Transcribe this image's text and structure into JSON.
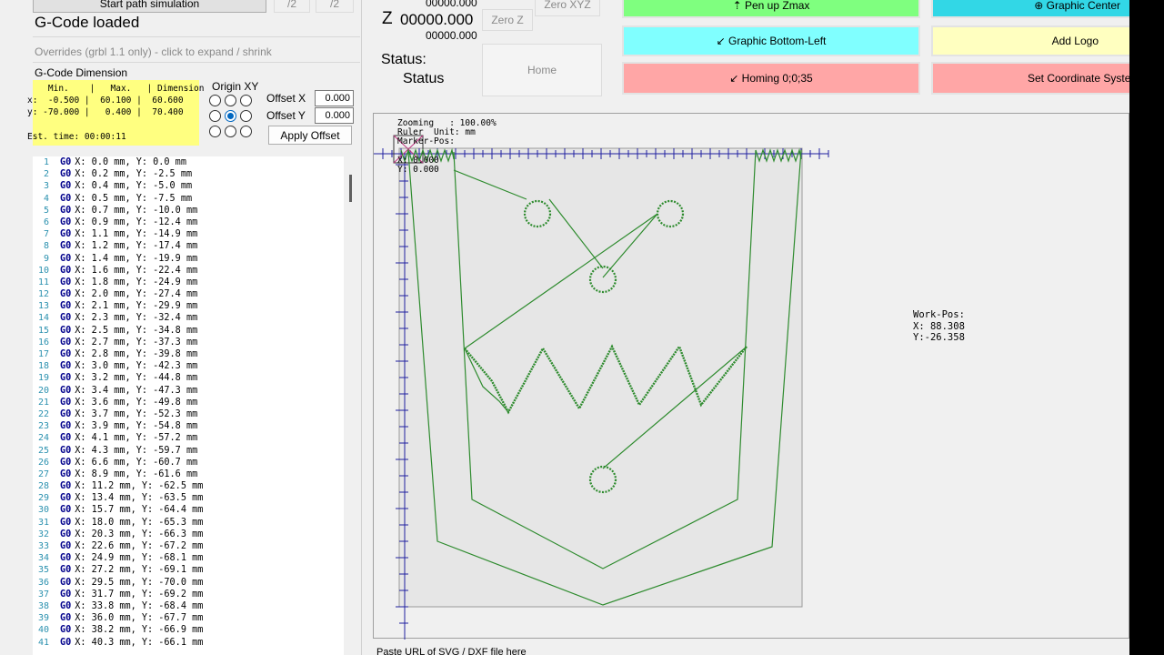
{
  "left_panel": {
    "sim_button": "Start path simulation",
    "small_btn_1": "/2",
    "small_btn_2": "/2",
    "gcode_status": "G-Code loaded",
    "overrides_text": "Overrides (grbl 1.1 only) - click to expand / shrink",
    "dimension_title": "G-Code Dimension",
    "dim_table": {
      "header": "    Min.    |   Max.   | Dimension",
      "row_x": "x:  -0.500 |  60.100 |  60.600",
      "row_y": "y: -70.000 |   0.400 |  70.400",
      "est_time": "Est. time: 00:00:11"
    },
    "origin_label": "Origin XY",
    "offset_x_label": "Offset X",
    "offset_x_value": "0.000",
    "offset_y_label": "Offset Y",
    "offset_y_value": "0.000",
    "apply_offset": "Apply Offset"
  },
  "gcode_lines": [
    {
      "n": "1",
      "cmd": "G0",
      "txt": "X: 0.0 mm, Y: 0.0 mm"
    },
    {
      "n": "2",
      "cmd": "G0",
      "txt": "X: 0.2 mm, Y: -2.5 mm"
    },
    {
      "n": "3",
      "cmd": "G0",
      "txt": "X: 0.4 mm, Y: -5.0 mm"
    },
    {
      "n": "4",
      "cmd": "G0",
      "txt": "X: 0.5 mm, Y: -7.5 mm"
    },
    {
      "n": "5",
      "cmd": "G0",
      "txt": "X: 0.7 mm, Y: -10.0 mm"
    },
    {
      "n": "6",
      "cmd": "G0",
      "txt": "X: 0.9 mm, Y: -12.4 mm"
    },
    {
      "n": "7",
      "cmd": "G0",
      "txt": "X: 1.1 mm, Y: -14.9 mm"
    },
    {
      "n": "8",
      "cmd": "G0",
      "txt": "X: 1.2 mm, Y: -17.4 mm"
    },
    {
      "n": "9",
      "cmd": "G0",
      "txt": "X: 1.4 mm, Y: -19.9 mm"
    },
    {
      "n": "10",
      "cmd": "G0",
      "txt": "X: 1.6 mm, Y: -22.4 mm"
    },
    {
      "n": "11",
      "cmd": "G0",
      "txt": "X: 1.8 mm, Y: -24.9 mm"
    },
    {
      "n": "12",
      "cmd": "G0",
      "txt": "X: 2.0 mm, Y: -27.4 mm"
    },
    {
      "n": "13",
      "cmd": "G0",
      "txt": "X: 2.1 mm, Y: -29.9 mm"
    },
    {
      "n": "14",
      "cmd": "G0",
      "txt": "X: 2.3 mm, Y: -32.4 mm"
    },
    {
      "n": "15",
      "cmd": "G0",
      "txt": "X: 2.5 mm, Y: -34.8 mm"
    },
    {
      "n": "16",
      "cmd": "G0",
      "txt": "X: 2.7 mm, Y: -37.3 mm"
    },
    {
      "n": "17",
      "cmd": "G0",
      "txt": "X: 2.8 mm, Y: -39.8 mm"
    },
    {
      "n": "18",
      "cmd": "G0",
      "txt": "X: 3.0 mm, Y: -42.3 mm"
    },
    {
      "n": "19",
      "cmd": "G0",
      "txt": "X: 3.2 mm, Y: -44.8 mm"
    },
    {
      "n": "20",
      "cmd": "G0",
      "txt": "X: 3.4 mm, Y: -47.3 mm"
    },
    {
      "n": "21",
      "cmd": "G0",
      "txt": "X: 3.6 mm, Y: -49.8 mm"
    },
    {
      "n": "22",
      "cmd": "G0",
      "txt": "X: 3.7 mm, Y: -52.3 mm"
    },
    {
      "n": "23",
      "cmd": "G0",
      "txt": "X: 3.9 mm, Y: -54.8 mm"
    },
    {
      "n": "24",
      "cmd": "G0",
      "txt": "X: 4.1 mm, Y: -57.2 mm"
    },
    {
      "n": "25",
      "cmd": "G0",
      "txt": "X: 4.3 mm, Y: -59.7 mm"
    },
    {
      "n": "26",
      "cmd": "G0",
      "txt": "X: 6.6 mm, Y: -60.7 mm"
    },
    {
      "n": "27",
      "cmd": "G0",
      "txt": "X: 8.9 mm, Y: -61.6 mm"
    },
    {
      "n": "28",
      "cmd": "G0",
      "txt": "X: 11.2 mm, Y: -62.5 mm"
    },
    {
      "n": "29",
      "cmd": "G0",
      "txt": "X: 13.4 mm, Y: -63.5 mm"
    },
    {
      "n": "30",
      "cmd": "G0",
      "txt": "X: 15.7 mm, Y: -64.4 mm"
    },
    {
      "n": "31",
      "cmd": "G0",
      "txt": "X: 18.0 mm, Y: -65.3 mm"
    },
    {
      "n": "32",
      "cmd": "G0",
      "txt": "X: 20.3 mm, Y: -66.3 mm"
    },
    {
      "n": "33",
      "cmd": "G0",
      "txt": "X: 22.6 mm, Y: -67.2 mm"
    },
    {
      "n": "34",
      "cmd": "G0",
      "txt": "X: 24.9 mm, Y: -68.1 mm"
    },
    {
      "n": "35",
      "cmd": "G0",
      "txt": "X: 27.2 mm, Y: -69.1 mm"
    },
    {
      "n": "36",
      "cmd": "G0",
      "txt": "X: 29.5 mm, Y: -70.0 mm"
    },
    {
      "n": "37",
      "cmd": "G0",
      "txt": "X: 31.7 mm, Y: -69.2 mm"
    },
    {
      "n": "38",
      "cmd": "G0",
      "txt": "X: 33.8 mm, Y: -68.4 mm"
    },
    {
      "n": "39",
      "cmd": "G0",
      "txt": "X: 36.0 mm, Y: -67.7 mm"
    },
    {
      "n": "40",
      "cmd": "G0",
      "txt": "X: 38.2 mm, Y: -66.9 mm"
    },
    {
      "n": "41",
      "cmd": "G0",
      "txt": "X: 40.3 mm, Y: -66.1 mm"
    }
  ],
  "machine": {
    "z_label": "Z",
    "z_value": "00000.000",
    "top_value": "00000.000",
    "sub_value": "00000.000",
    "zero_z": "Zero Z",
    "zero_xyz": "Zero XYZ",
    "status_label": "Status:",
    "status_value": "Status",
    "home": "Home"
  },
  "custom_buttons": {
    "pen_up": "⇡ Pen up Zmax",
    "graphic_center": "⊕ Graphic Center",
    "bottom_left": "↙ Graphic Bottom-Left",
    "add_logo": "Add Logo",
    "homing": "↙ Homing 0;0;35",
    "set_coord": "Set Coordinate System"
  },
  "colors": {
    "green": "#7fff7f",
    "cyan": "#32d7e6",
    "lightcyan": "#80ffff",
    "lightyellow": "#ffffc0",
    "pink": "#ffa6a6",
    "path": "#2e8b2e",
    "dim_bg": "#ffff80"
  },
  "canvas": {
    "zoom_label": "Zooming   : 100.00%",
    "ruler_label": "Ruler  Unit: mm",
    "marker_label": "Marker-Pos:",
    "marker_x": "X: 0.000",
    "marker_y": "Y: 0.000",
    "workpos_title": "Work-Pos:",
    "workpos_x": "X: 88.308",
    "workpos_y": "Y:-26.358"
  },
  "bottom_hint": "Paste URL of SVG / DXF file here"
}
